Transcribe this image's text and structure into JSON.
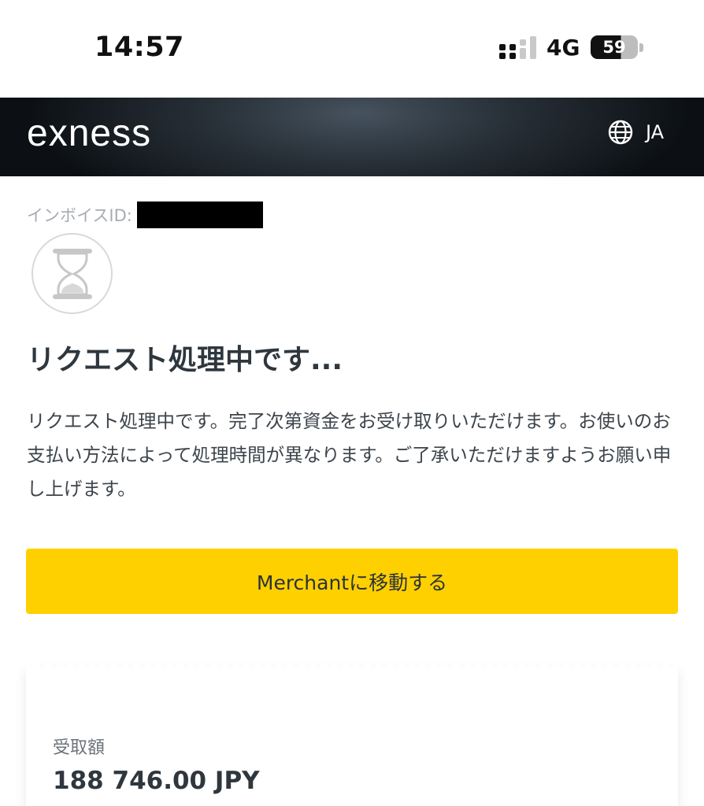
{
  "status_bar": {
    "time": "14:57",
    "network": "4G",
    "battery": "59"
  },
  "header": {
    "logo": "exness",
    "language": "JA",
    "language_icon": "globe-icon"
  },
  "invoice": {
    "label": "インボイスID:"
  },
  "status_icon": "hourglass-icon",
  "main": {
    "title": "リクエスト処理中です...",
    "description": "リクエスト処理中です。完了次第資金をお受け取りいただけます。お使いのお支払い方法によって処理時間が異なります。ご了承いただけますようお願い申し上げます。",
    "button_label": "Merchantに移動する"
  },
  "receipt": {
    "label": "受取額",
    "amount": "188 746.00 JPY"
  },
  "colors": {
    "accent": "#ffd000",
    "header_dark": "#0c1014",
    "text": "#2f373e",
    "muted": "#a7acb1"
  }
}
